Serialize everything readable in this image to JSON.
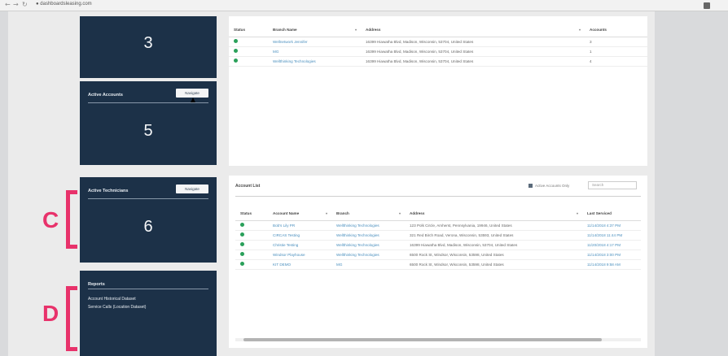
{
  "browser": {
    "back": "←",
    "forward": "→",
    "reload": "↻",
    "url": "● dashboardsleasing.com"
  },
  "tiles": {
    "top": {
      "value": "3"
    },
    "active_accounts": {
      "label": "Active Accounts",
      "button": "Navigate",
      "value": "5"
    },
    "active_technicians": {
      "label": "Active Technicians",
      "button": "Navigate",
      "value": "6"
    },
    "reports": {
      "label": "Reports",
      "links": [
        "Account Historical Dataset",
        "Service Calls (Location Dataset)"
      ]
    }
  },
  "branch_table": {
    "headers": [
      "Status",
      "Branch Name",
      "Address",
      "Accounts"
    ],
    "rows": [
      {
        "name": "Wellnetwork Jennifer",
        "address": "16399 Hiawatha Blvd, Madison, Wisconsin, 53704, United States",
        "accounts": "3"
      },
      {
        "name": "MG",
        "address": "16399 Hiawatha Blvd, Madison, Wisconsin, 53704, United States",
        "accounts": "1"
      },
      {
        "name": "Wellthinking Technologies",
        "address": "16399 Hiawatha Blvd, Madison, Wisconsin, 53704, United States",
        "accounts": "4"
      }
    ]
  },
  "account_list": {
    "title": "Account List",
    "checkbox_label": "Active Accounts Only",
    "search_placeholder": "Search",
    "headers": [
      "Status",
      "Account Name",
      "Branch",
      "Address",
      "Last Serviced"
    ],
    "rows": [
      {
        "name": "Bob's Lily PR",
        "branch": "Wellthinking Technologies",
        "address": "123 Polk Circle, Amherst, Pennsylvania, 19946, United States",
        "last": "11/14/2018 4:37 PM"
      },
      {
        "name": "CIRCAS Testing",
        "branch": "Wellthinking Technologies",
        "address": "321 Red Birch Road, Verona, Wisconsin, 53593, United States",
        "last": "11/14/2018 11:44 PM"
      },
      {
        "name": "Christie Testing",
        "branch": "Wellthinking Technologies",
        "address": "16399 Hiawatha Blvd, Madison, Wisconsin, 53704, United States",
        "last": "11/20/2018 4:17 PM"
      },
      {
        "name": "Windsor Playhouse",
        "branch": "Wellthinking Technologies",
        "address": "6500 Rock St, Windsor, Wisconsin, 53598, United States",
        "last": "11/14/2018 3:00 PM"
      },
      {
        "name": "KIT DEMO",
        "branch": "MG",
        "address": "6500 Rock St, Windsor, Wisconsin, 53598, United States",
        "last": "11/14/2018 9:58 AM"
      }
    ]
  },
  "annotations": {
    "c": "C",
    "d": "D"
  },
  "colors": {
    "tile_bg": "#1c3148",
    "status_green": "#2aa05a",
    "link_blue": "#4a8fbe",
    "annotation": "#e8326b"
  }
}
